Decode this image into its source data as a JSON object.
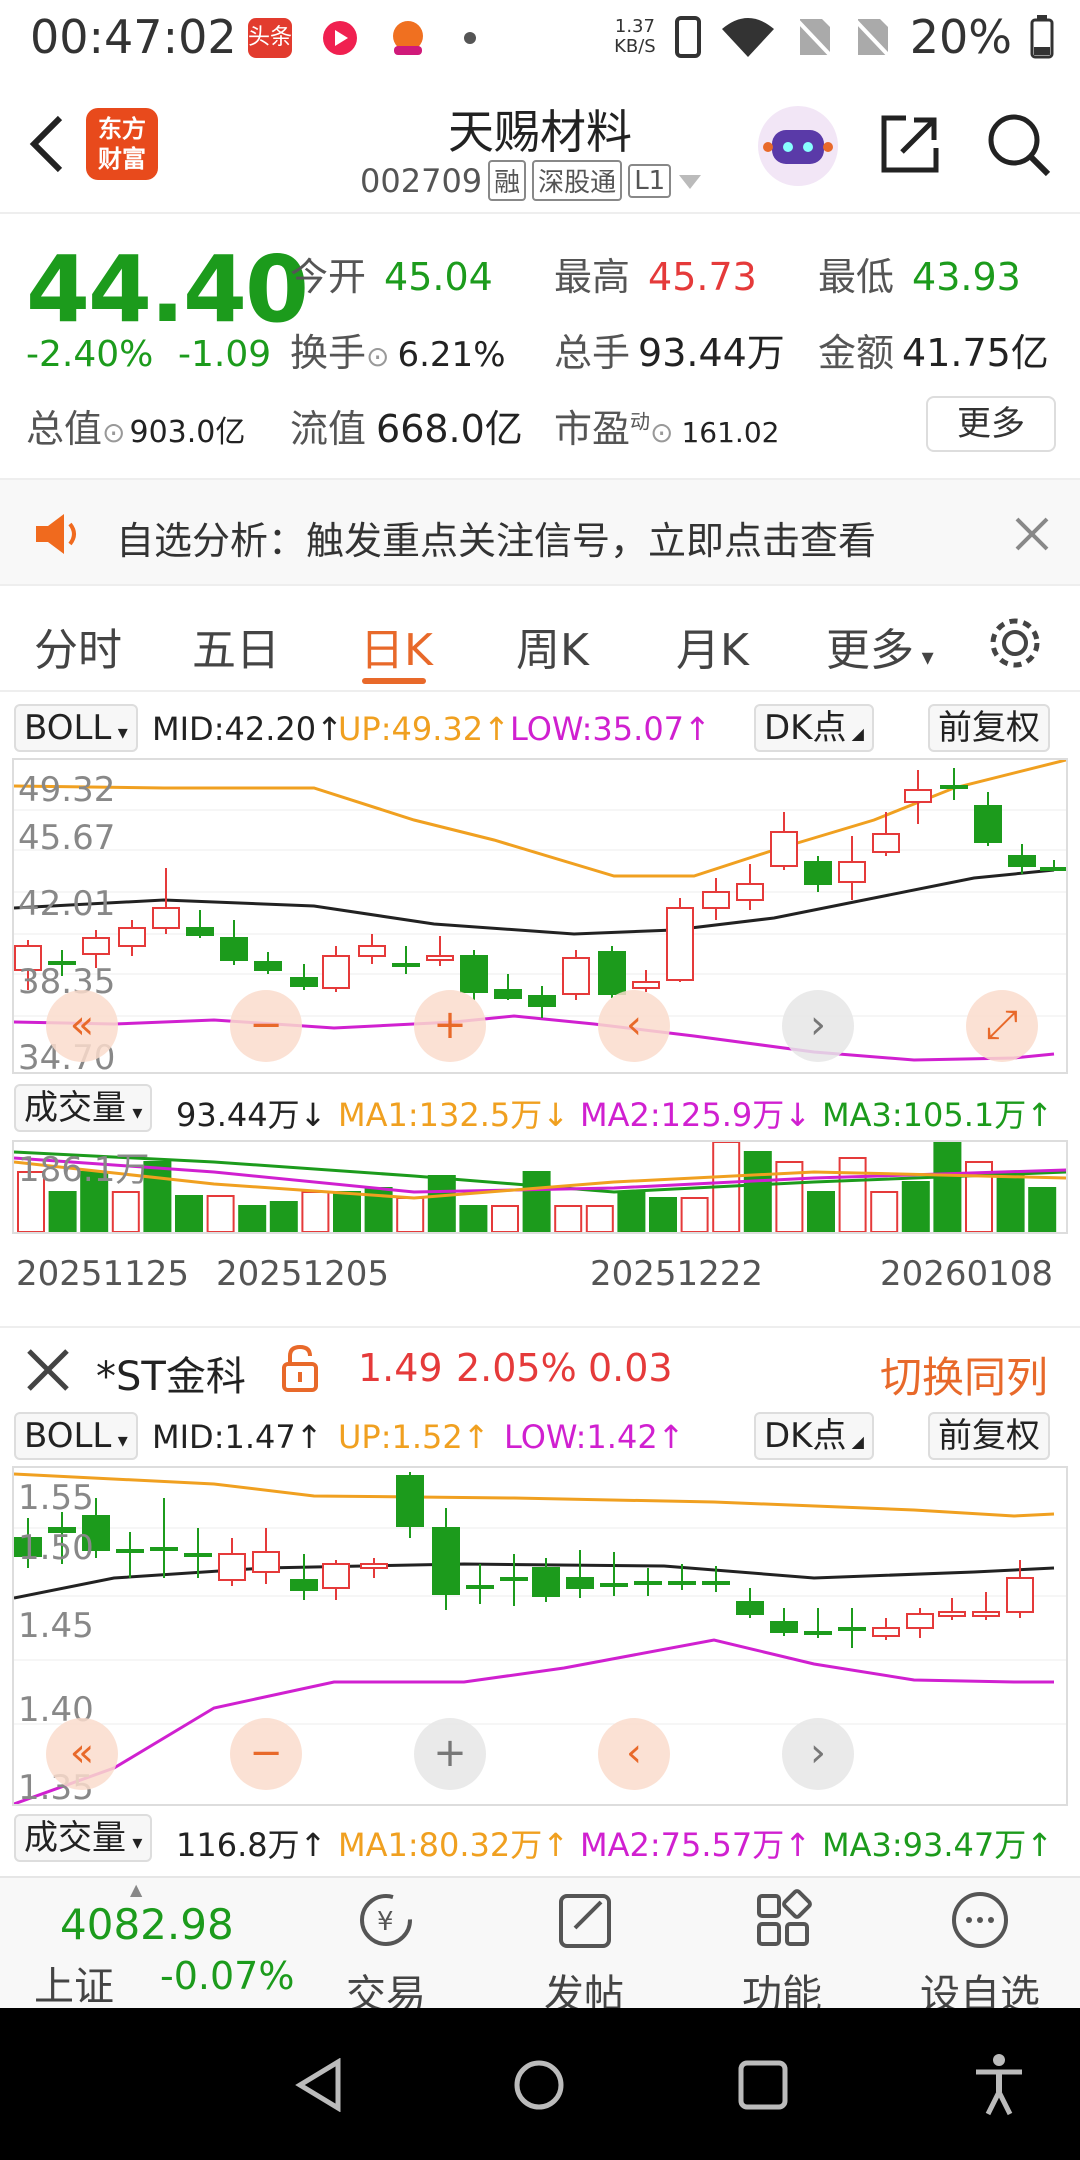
{
  "status_bar": {
    "time": "00:47:02",
    "net_speed": "1.37",
    "net_unit": "KB/S",
    "battery": "20%",
    "app_icons": [
      "toutiao-icon",
      "video-icon",
      "app-icon",
      "dot"
    ],
    "toutiao_label": "头条"
  },
  "header": {
    "back_icon": "chevron-left-icon",
    "logo_text": "东方财富",
    "stock_name": "天赐材料",
    "stock_code": "002709",
    "tags": [
      "融",
      "深股通",
      "L1"
    ],
    "share_icon": "share-icon",
    "search_icon": "search-icon"
  },
  "quote": {
    "price": "44.40",
    "change_pct": "-2.40%",
    "change_amt": "-1.09",
    "open_label": "今开",
    "open": "45.04",
    "high_label": "最高",
    "high": "45.73",
    "low_label": "最低",
    "low": "43.93",
    "turnover_label": "换手",
    "turnover": "6.21%",
    "volume_label": "总手",
    "volume": "93.44万",
    "amount_label": "金额",
    "amount": "41.75亿",
    "mktcap_label": "总值",
    "mktcap": "903.0亿",
    "float_label": "流值",
    "float": "668.0亿",
    "pe_label": "市盈",
    "pe_sup": "动",
    "pe": "161.02",
    "more_label": "更多"
  },
  "notice": {
    "text": "自选分析：触发重点关注信号，立即点击查看"
  },
  "tabs": [
    "分时",
    "五日",
    "日K",
    "周K",
    "月K",
    "更多"
  ],
  "active_tab": "日K",
  "chart1": {
    "indicator": "BOLL",
    "mid": "MID:42.20↑",
    "up": "UP:49.32↑",
    "low": "LOW:35.07↑",
    "dk": "DK点",
    "adj": "前复权",
    "y_labels": [
      "49.32",
      "45.67",
      "42.01",
      "38.35",
      "34.70"
    ],
    "vol_label": "成交量",
    "vol": "93.44万↓",
    "ma1": "MA1:132.5万↓",
    "ma2": "MA2:125.9万↓",
    "ma3": "MA3:105.1万↑",
    "vol_max": "186.1万",
    "dates": [
      "20251125",
      "20251205",
      "20251222",
      "20260108"
    ]
  },
  "compare": {
    "name": "*ST金科",
    "price": "1.49",
    "pct": "2.05%",
    "chg": "0.03",
    "switch_label": "切换同列"
  },
  "chart2": {
    "indicator": "BOLL",
    "mid": "MID:1.47↑",
    "up": "UP:1.52↑",
    "low": "LOW:1.42↑",
    "dk": "DK点",
    "adj": "前复权",
    "y_labels": [
      "1.55",
      "1.50",
      "1.45",
      "1.40",
      "1.35"
    ],
    "vol_label": "成交量",
    "vol": "116.8万↑",
    "ma1": "MA1:80.32万↑",
    "ma2": "MA2:75.57万↑",
    "ma3": "MA3:93.47万↑"
  },
  "bottom_nav": {
    "index_value": "4082.98",
    "index_name": "上证",
    "index_pct": "-0.07%",
    "items": [
      "交易",
      "发帖",
      "功能",
      "设自选"
    ]
  },
  "colors": {
    "up": "#e53a3a",
    "down": "#1c9b1c",
    "accent": "#e8692a",
    "boll_up": "#f0a020",
    "boll_low": "#d020d0",
    "boll_mid": "#222222"
  }
}
